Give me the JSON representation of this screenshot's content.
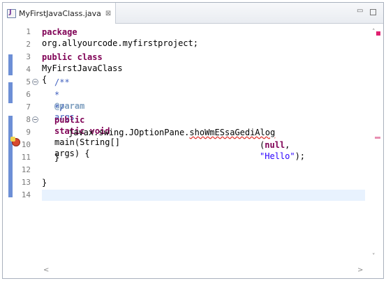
{
  "tab": {
    "title": "MyFirstJavaClass.java",
    "close_symbol": "⊠",
    "file_icon": "java-file-icon"
  },
  "window": {
    "minimize_symbol": "▭"
  },
  "colors": {
    "keyword": "#7f0055",
    "comment": "#3f5fbf",
    "string": "#2a00ff",
    "error": "#e0302a",
    "current_line": "#e8f2fe"
  },
  "lines": [
    {
      "num": "1",
      "text": "package org.allyourcode.myfirstproject;"
    },
    {
      "num": "2",
      "text": ""
    },
    {
      "num": "3",
      "text": "public class MyFirstJavaClass {"
    },
    {
      "num": "4",
      "text": ""
    },
    {
      "num": "5",
      "text": "/**"
    },
    {
      "num": "6",
      "text": " * @param args"
    },
    {
      "num": "7",
      "text": " */"
    },
    {
      "num": "8",
      "text": "public static void main(String[] args) {"
    },
    {
      "num": "9",
      "text": "javax.swing.JOptionPane.shoWmESsaGediAlog"
    },
    {
      "num": "10",
      "text": "(null, \"Hello\");"
    },
    {
      "num": "11",
      "text": "}"
    },
    {
      "num": "12",
      "text": ""
    },
    {
      "num": "13",
      "text": "}"
    },
    {
      "num": "14",
      "text": ""
    }
  ],
  "tokens": {
    "l1_kw": "package",
    "l1_rest": " org.allyourcode.myfirstproject;",
    "l3_kw1": "public",
    "l3_kw2": "class",
    "l3_rest": " MyFirstJavaClass {",
    "l5": "/**",
    "l6_star": " * ",
    "l6_tag": "@param",
    "l6_rest": " args",
    "l7": " */",
    "l8_kw1": "public",
    "l8_kw2": "static",
    "l8_kw3": "void",
    "l8_rest": " main(String[] args) {",
    "l9_prefix": "javax.swing.JOptionPane.",
    "l9_err": "shoWmESsaGediAlog",
    "l10_open": "(",
    "l10_null": "null",
    "l10_comma": ", ",
    "l10_str": "\"Hello\"",
    "l10_close": ");",
    "l11": "}",
    "l13": "}"
  },
  "scroll": {
    "up": "˄",
    "down": "˅",
    "left": "<",
    "right": ">"
  }
}
